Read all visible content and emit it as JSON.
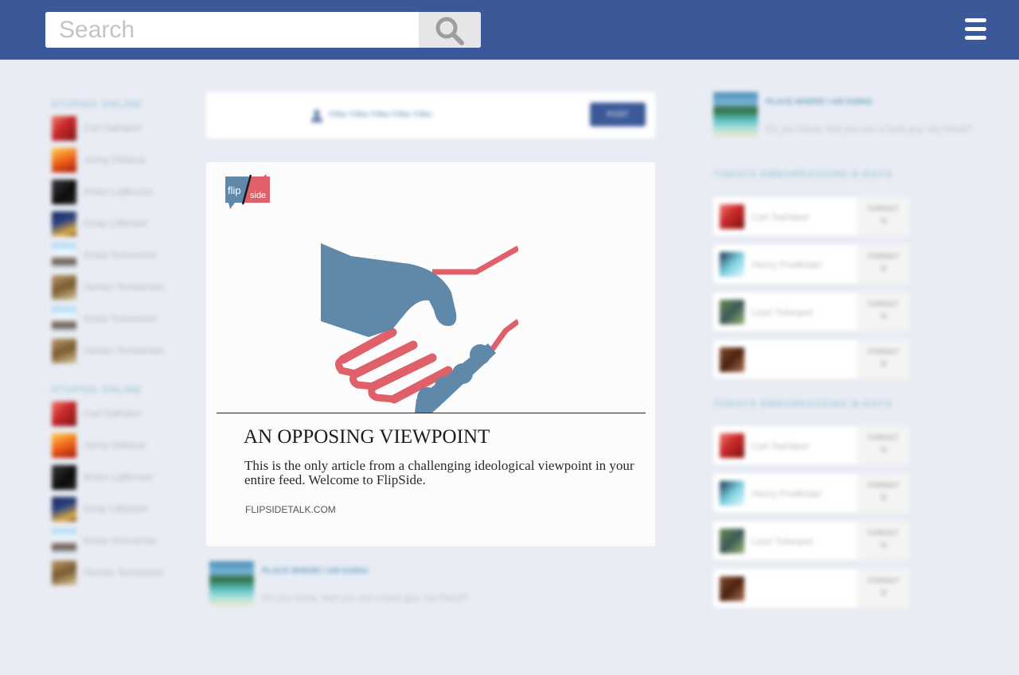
{
  "search": {
    "placeholder": "Search"
  },
  "left_sidebar": {
    "sections": [
      {
        "heading": "STUPIDS ONLINE",
        "friends": [
          {
            "name": "Carl Sakfaker",
            "avatar": "av-red"
          },
          {
            "name": "Johny Dikbicar",
            "avatar": "av-fire"
          },
          {
            "name": "Anton Lajfkruzer",
            "avatar": "av-dark"
          },
          {
            "name": "Emily Liftforbet",
            "avatar": "av-night"
          },
          {
            "name": "Krista Tonevenim",
            "avatar": "av-sky"
          },
          {
            "name": "Henten Tembenten",
            "avatar": "av-horse"
          },
          {
            "name": "Krista Tonevenim",
            "avatar": "av-sky"
          },
          {
            "name": "Henten Tembenten",
            "avatar": "av-horse"
          }
        ]
      },
      {
        "heading": "STUPIDS ONLINE",
        "friends": [
          {
            "name": "Carl Sakfaker",
            "avatar": "av-red"
          },
          {
            "name": "Johny Dikbicar",
            "avatar": "av-fire"
          },
          {
            "name": "Anton Lajfkruzer",
            "avatar": "av-dark"
          },
          {
            "name": "Emily Liftforbet",
            "avatar": "av-night"
          },
          {
            "name": "Krista Tonevenim",
            "avatar": "av-sky"
          },
          {
            "name": "Henten Tembenten",
            "avatar": "av-horse"
          }
        ]
      }
    ]
  },
  "composer": {
    "placeholder": "Filler Filler Filler Filler Filler",
    "post_label": "POST"
  },
  "flipside_card": {
    "logo_left": "flip",
    "logo_right": "side",
    "title": "AN OPPOSING VIEWPOINT",
    "description": "This is the only article from a challenging ideological viewpoint in your entire feed. Welcome to FlipSide.",
    "link": "FLIPSIDETALK.COM",
    "colors": {
      "blue": "#6088a8",
      "red": "#e0606a"
    }
  },
  "feed_post": {
    "title": "PLACE WHERE I AM GOING",
    "text": "Do you know, that you are a best guy, my friend?"
  },
  "right_sidebar": {
    "top_post": {
      "title": "PLACE WHERE I AM GOING",
      "text": "Do you know, that you are a best guy, my friend?"
    },
    "sections": [
      {
        "heading": "TODAYS EMBARRASSING B-DAYS",
        "items": [
          {
            "name": "Carl Sakfaker",
            "avatar": "av-red",
            "action": "FORGET",
            "close": "✕"
          },
          {
            "name": "Henry Findfinder",
            "avatar": "av-ice",
            "action": "FORGET",
            "close": "✕"
          },
          {
            "name": "Lauri Tofenprd",
            "avatar": "av-green",
            "action": "FORGET",
            "close": "✕"
          },
          {
            "name": "",
            "avatar": "av-brown",
            "action": "FORGET",
            "close": "✕"
          }
        ]
      },
      {
        "heading": "TODAYS EMBARRASSING B-DAYS",
        "items": [
          {
            "name": "Carl Sakfaker",
            "avatar": "av-red",
            "action": "FORGET",
            "close": "✕"
          },
          {
            "name": "Henry Findfinder",
            "avatar": "av-ice",
            "action": "FORGET",
            "close": "✕"
          },
          {
            "name": "Lauri Tofenprd",
            "avatar": "av-green",
            "action": "FORGET",
            "close": "✕"
          },
          {
            "name": "",
            "avatar": "av-brown",
            "action": "FORGET",
            "close": "✕"
          }
        ]
      }
    ]
  },
  "icons": {
    "search": "search-icon",
    "menu": "hamburger-menu-icon"
  },
  "theme": {
    "header": "#3b5998",
    "background": "#e9ecf4"
  }
}
